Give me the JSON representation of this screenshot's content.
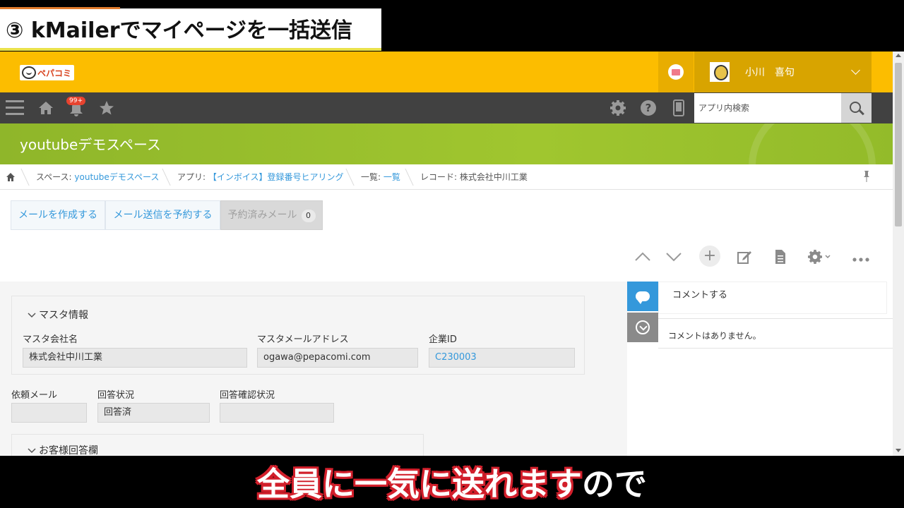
{
  "overlay": {
    "chapter_title": "③ kMailerでマイページを一括送信",
    "subtitle_main": "全員に一気に送れます",
    "subtitle_tail": "ので"
  },
  "header": {
    "logo_text": "ペパコミ",
    "user_name": "小川　喜句"
  },
  "toolbar": {
    "notification_badge": "99+",
    "search_placeholder": "アプリ内検索"
  },
  "space": {
    "title": "youtubeデモスペース"
  },
  "breadcrumb": {
    "space_prefix": "スペース: ",
    "space_link": "youtubeデモスペース",
    "app_prefix": "アプリ: ",
    "app_link": "【インボイス】登録番号ヒアリング",
    "list_prefix": "一覧: ",
    "list_link": "一覧",
    "record": "レコード: 株式会社中川工業"
  },
  "kmailer": {
    "create_label": "メールを作成する",
    "schedule_label": "メール送信を予約する",
    "scheduled_label": "予約済みメール",
    "scheduled_count": "0"
  },
  "form": {
    "master_section": "マスタ情報",
    "master_company_label": "マスタ会社名",
    "master_company_value": "株式会社中川工業",
    "master_email_label": "マスタメールアドレス",
    "master_email_value": "ogawa@pepacomi.com",
    "company_id_label": "企業ID",
    "company_id_value": "C230003",
    "request_mail_label": "依頼メール",
    "request_mail_value": "",
    "answer_status_label": "回答状況",
    "answer_status_value": "回答済",
    "answer_check_label": "回答確認状況",
    "answer_check_value": "",
    "customer_section": "お客様回答欄"
  },
  "comments": {
    "input_placeholder": "コメントする",
    "empty_text": "コメントはありません。"
  },
  "colors": {
    "header": "#fcbd00",
    "toolbar": "#414141",
    "space_banner": "#9dc22e",
    "link": "#3498db"
  }
}
